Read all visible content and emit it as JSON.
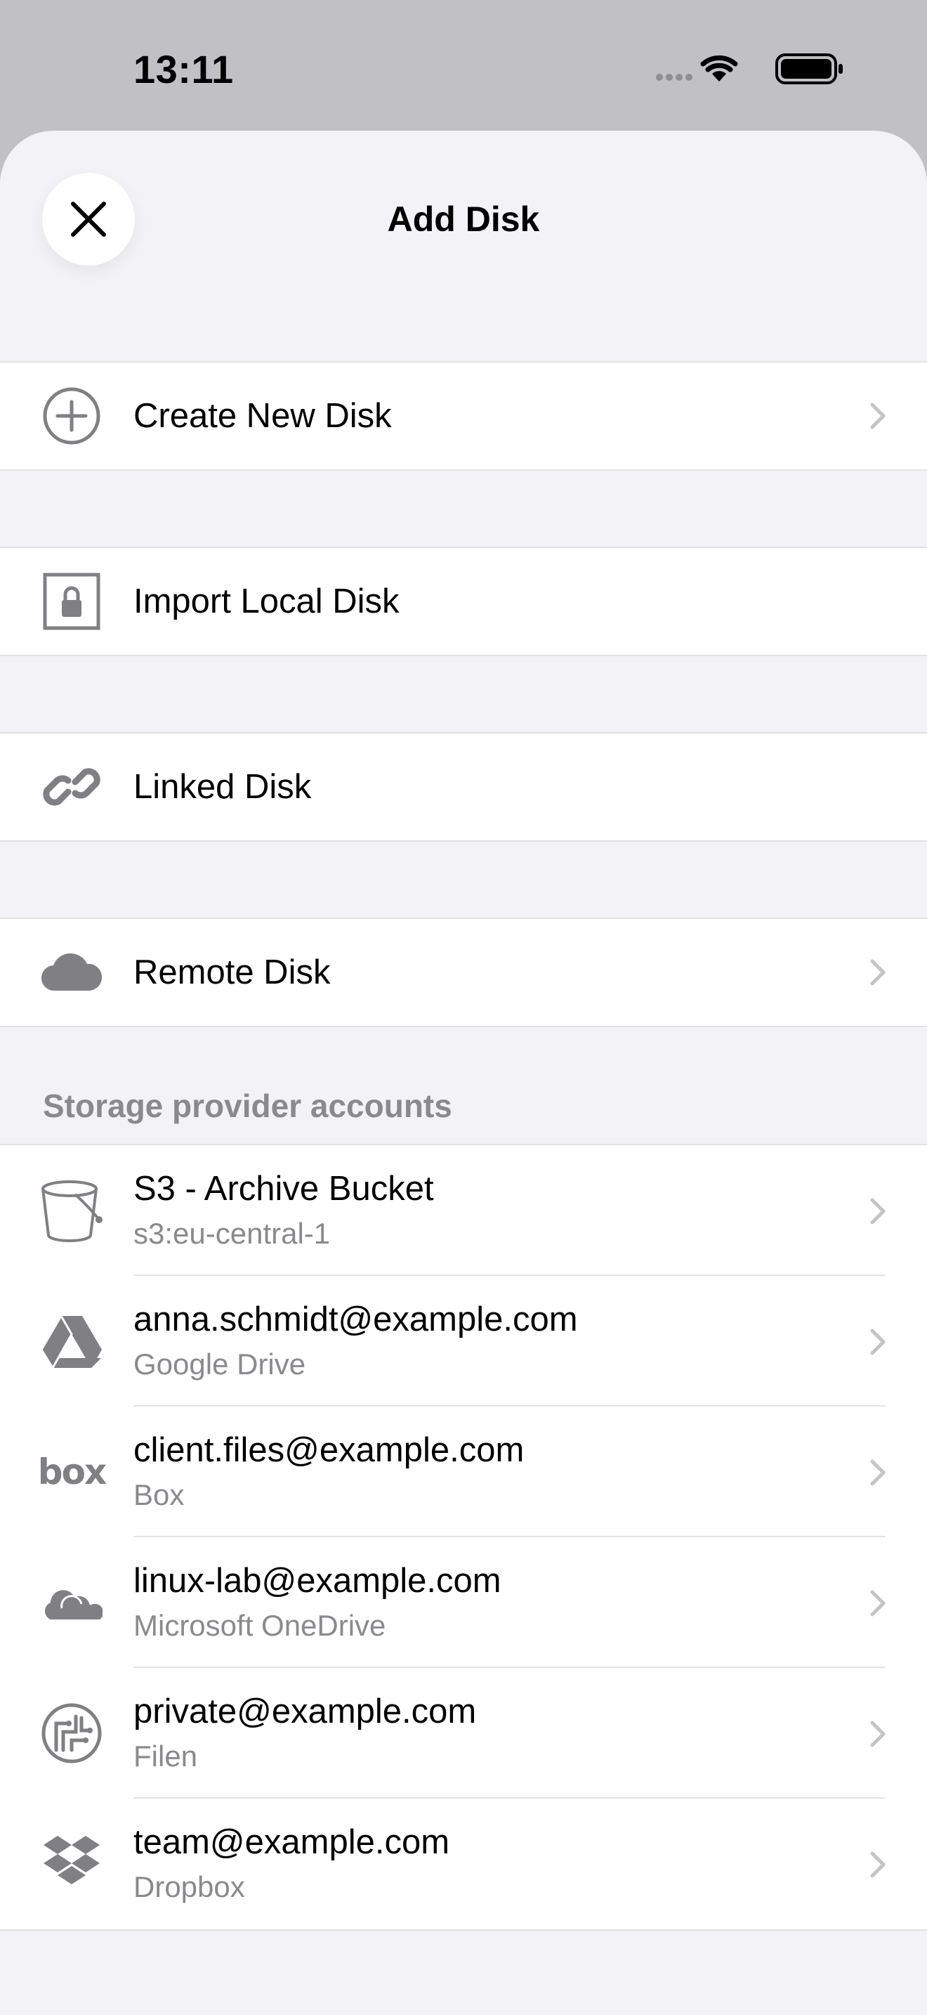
{
  "status": {
    "time": "13:11"
  },
  "sheet": {
    "title": "Add Disk"
  },
  "actions": [
    {
      "label": "Create New Disk",
      "icon": "plus-circle-icon",
      "chevron": true
    },
    {
      "label": "Import Local Disk",
      "icon": "lock-box-icon",
      "chevron": false
    },
    {
      "label": "Linked Disk",
      "icon": "link-icon",
      "chevron": false
    },
    {
      "label": "Remote Disk",
      "icon": "cloud-icon",
      "chevron": true
    }
  ],
  "accounts": {
    "header": "Storage provider accounts",
    "items": [
      {
        "title": "S3 - Archive Bucket",
        "subtitle": "s3:eu-central-1",
        "icon": "bucket-icon"
      },
      {
        "title": "anna.schmidt@example.com",
        "subtitle": "Google Drive",
        "icon": "google-drive-icon"
      },
      {
        "title": "client.files@example.com",
        "subtitle": "Box",
        "icon": "box-logo-icon",
        "logo_text": "box"
      },
      {
        "title": "linux-lab@example.com",
        "subtitle": "Microsoft OneDrive",
        "icon": "onedrive-icon"
      },
      {
        "title": "private@example.com",
        "subtitle": "Filen",
        "icon": "filen-icon"
      },
      {
        "title": "team@example.com",
        "subtitle": "Dropbox",
        "icon": "dropbox-icon"
      }
    ]
  },
  "colors": {
    "sheet_bg": "#f2f2f7",
    "dim_bg": "#c0c0c5",
    "icon_gray": "#7f7f84",
    "secondary_text": "#8a8a8e"
  }
}
